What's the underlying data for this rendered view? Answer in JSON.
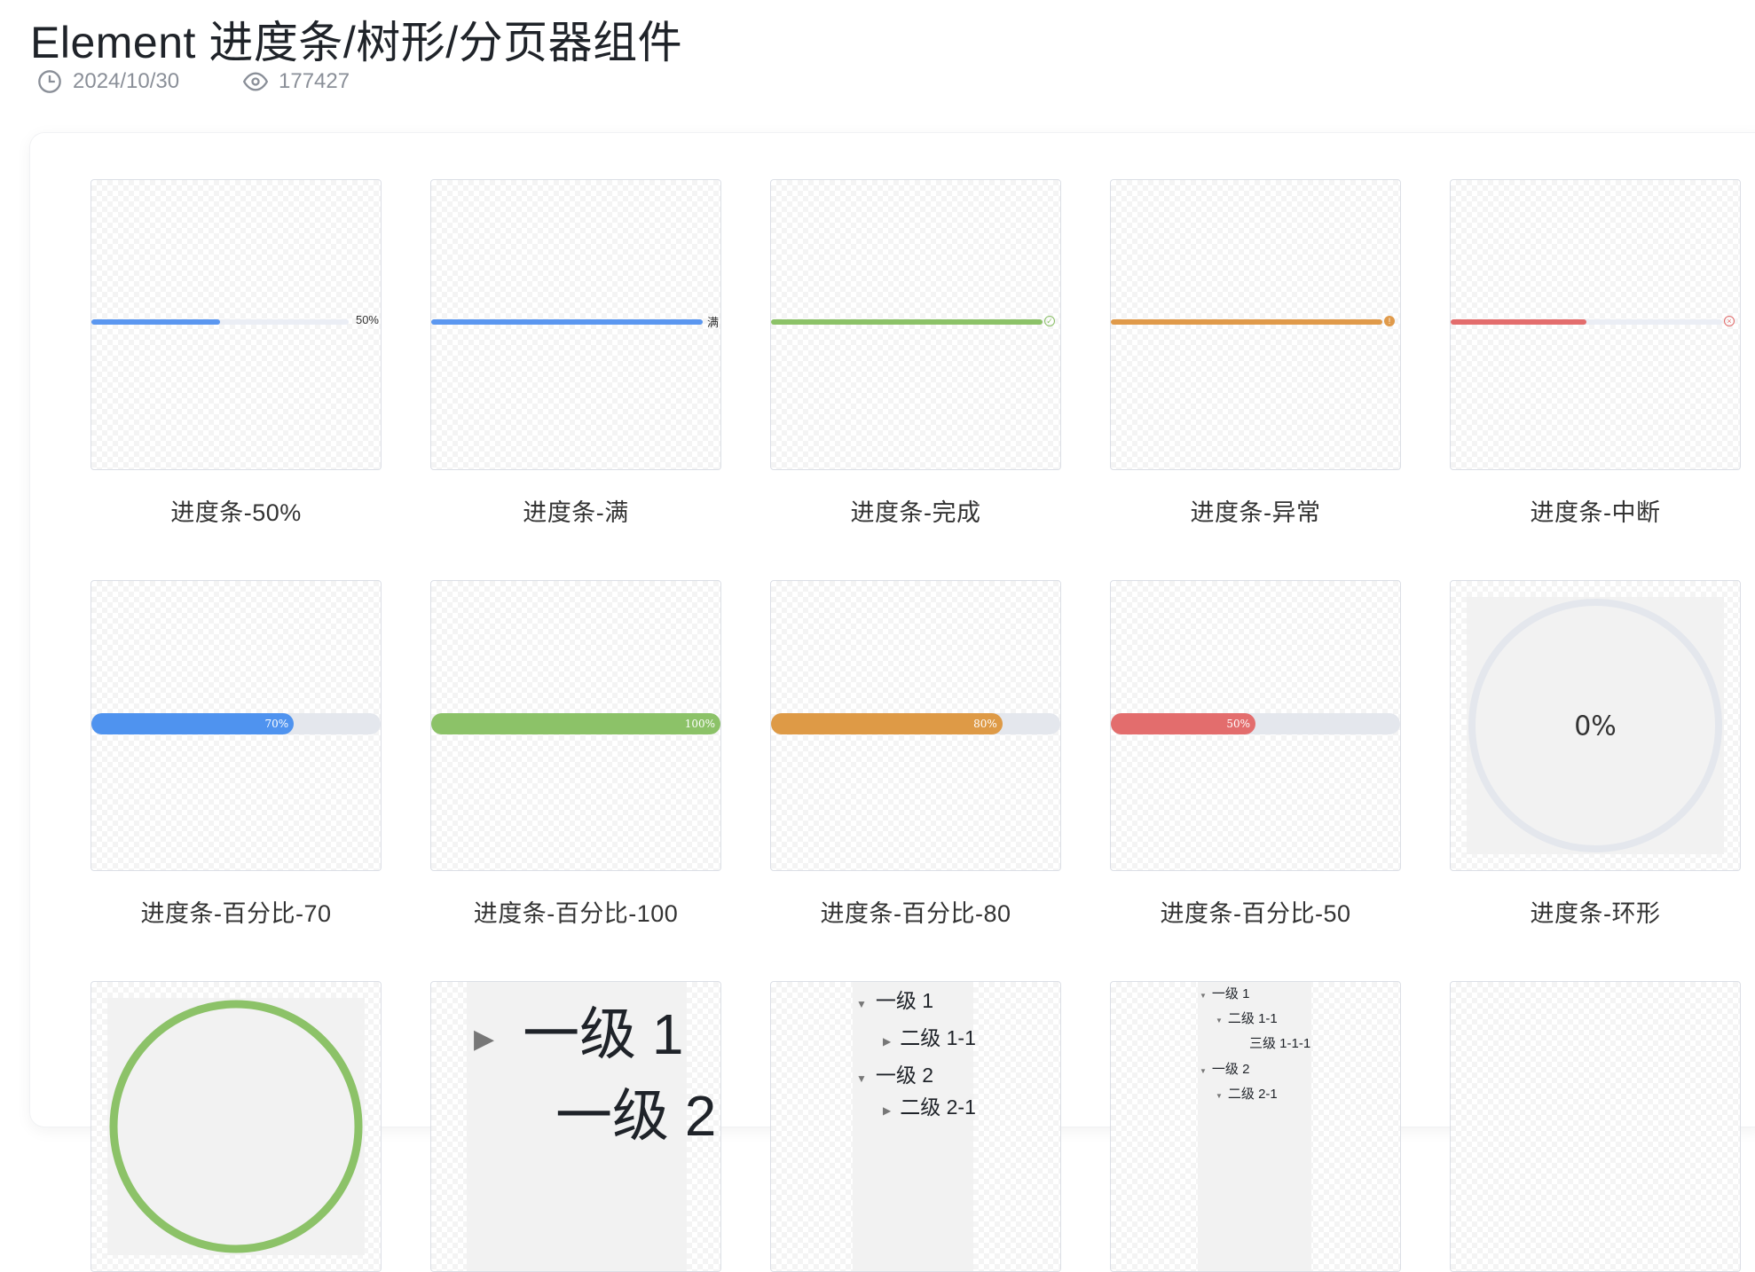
{
  "header": {
    "title": "Element 进度条/树形/分页器组件",
    "date": "2024/10/30",
    "views": "177427"
  },
  "cards": [
    {
      "label": "进度条-50%",
      "progress_text": "50%",
      "percent": 50,
      "color": "#5b97f0"
    },
    {
      "label": "进度条-满",
      "progress_text": "满",
      "percent": 100,
      "color": "#5b97f0"
    },
    {
      "label": "进度条-完成",
      "percent": 100,
      "color": "#8cc268",
      "status": "success"
    },
    {
      "label": "进度条-异常",
      "percent": 100,
      "color": "#e09a4a",
      "status": "warning"
    },
    {
      "label": "进度条-中断",
      "percent": 50,
      "color": "#e36d6d",
      "status": "exception"
    },
    {
      "label": "进度条-百分比-70",
      "progress_text": "70%",
      "percent": 70,
      "color": "#4f93ef"
    },
    {
      "label": "进度条-百分比-100",
      "progress_text": "100%",
      "percent": 100,
      "color": "#8cc268"
    },
    {
      "label": "进度条-百分比-80",
      "progress_text": "80%",
      "percent": 80,
      "color": "#de9a46"
    },
    {
      "label": "进度条-百分比-50",
      "progress_text": "50%",
      "percent": 50,
      "color": "#e36d6d"
    },
    {
      "label": "进度条-环形",
      "progress_text": "0%",
      "percent": 0
    }
  ],
  "tree_a": {
    "level1_1": "一级 1",
    "level1_2": "一级 2"
  },
  "tree_b": {
    "level1_1": "一级 1",
    "level2_1": "二级 1-1",
    "level1_2": "一级 2",
    "level2_2": "二级 2-1"
  },
  "tree_c": {
    "level1_1": "一级 1",
    "level2_1": "二级 1-1",
    "level3_1": "三级 1-1-1",
    "level1_2": "一级 2",
    "level2_2": "二级 2-1"
  },
  "colors": {
    "success": "#8cc268",
    "warning": "#e09a4a",
    "danger": "#e36d6d",
    "primary": "#5b97f0"
  }
}
